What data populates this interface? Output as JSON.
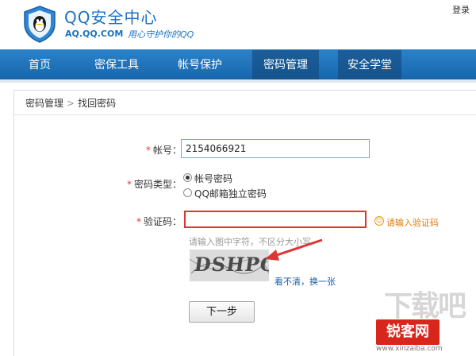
{
  "header": {
    "brand_title": "QQ安全中心",
    "brand_domain": "AQ.QQ.COM",
    "brand_slogan": "用心守护你的QQ",
    "login": "登录"
  },
  "nav": {
    "items": [
      {
        "label": "首页",
        "active": false
      },
      {
        "label": "密保工具",
        "active": false
      },
      {
        "label": "帐号保护",
        "active": false
      },
      {
        "label": "密码管理",
        "active": true
      },
      {
        "label": "安全学堂",
        "active": false
      }
    ]
  },
  "breadcrumb": {
    "parent": "密码管理",
    "separator": ">",
    "current": "找回密码"
  },
  "form": {
    "required_mark": "*",
    "account_label": "帐号：",
    "account_value": "2154066921",
    "password_type_label": "密码类型：",
    "password_type_options": [
      "帐号密码",
      "QQ邮箱独立密码"
    ],
    "password_type_selected": "帐号密码",
    "captcha_label": "验证码：",
    "captcha_value": "",
    "captcha_hint": "请输入验证码",
    "captcha_sub_hint": "请输入图中字符，不区分大小写",
    "captcha_image_text": "DSHPG",
    "refresh_link": "看不清，换一张",
    "next_button": "下一步"
  },
  "watermark": {
    "top": "下载吧",
    "badge": "锐客网",
    "url": "www.xinzaiba.com"
  },
  "colors": {
    "brand": "#1a72c4",
    "nav": "#1f73b8",
    "nav_active": "#1b5e9a",
    "required": "#e23b2e",
    "error_border": "#e03434",
    "hint": "#e07b10",
    "link": "#1a5fa8"
  }
}
